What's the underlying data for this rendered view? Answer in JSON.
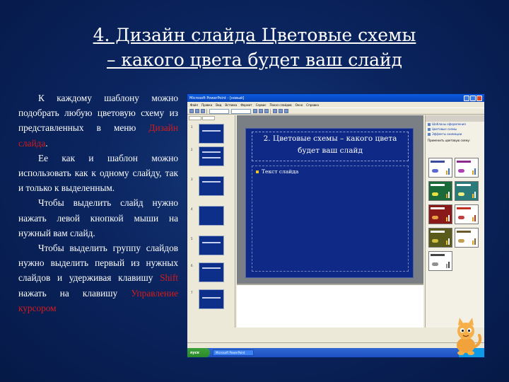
{
  "slide": {
    "title_line1": "4. Дизайн слайда Цветовые схемы",
    "title_line2": "– какого цвета будет ваш слайд",
    "body": {
      "p1_a": "К каждому шаблону можно подобрать любую цветовую схему из представленных в меню ",
      "p1_red": "Дизайн слайда",
      "p1_b": ".",
      "p2": "Ее как и шаблон можно использовать как к одному слайду, так и только к выделенным.",
      "p3": "Чтобы выделить слайд нужно нажать левой кнопкой мыши на нужный вам слайд.",
      "p4_a": "Чтобы выделить группу слайдов нужно выделить первый из нужных слайдов и удерживая клавишу ",
      "p4_red": "Shift",
      "p4_b": " нажать на клавишу ",
      "p4_red2": "Управление курсором"
    }
  },
  "ppt": {
    "window_title": "Microsoft PowerPoint - [новый]",
    "menu": [
      "Файл",
      "Правка",
      "Вид",
      "Вставка",
      "Формат",
      "Сервис",
      "Показ слайдов",
      "Окно",
      "Справка"
    ],
    "inner_slide_title_line1": "2. Цветовые схемы – какого цвета",
    "inner_slide_title_line2": "будет ваш слайд",
    "inner_slide_bullet": "Текст слайда",
    "thumb_numbers": [
      "1",
      "2",
      "3",
      "4",
      "5",
      "6",
      "7"
    ],
    "taskpane": {
      "links": [
        "Шаблоны оформления",
        "Цветовые схемы",
        "Эффекты анимации"
      ],
      "apply_label": "Применить цветовую схему:"
    },
    "taskbar": {
      "start": "пуск",
      "task": "Microsoft PowerPoint"
    }
  }
}
